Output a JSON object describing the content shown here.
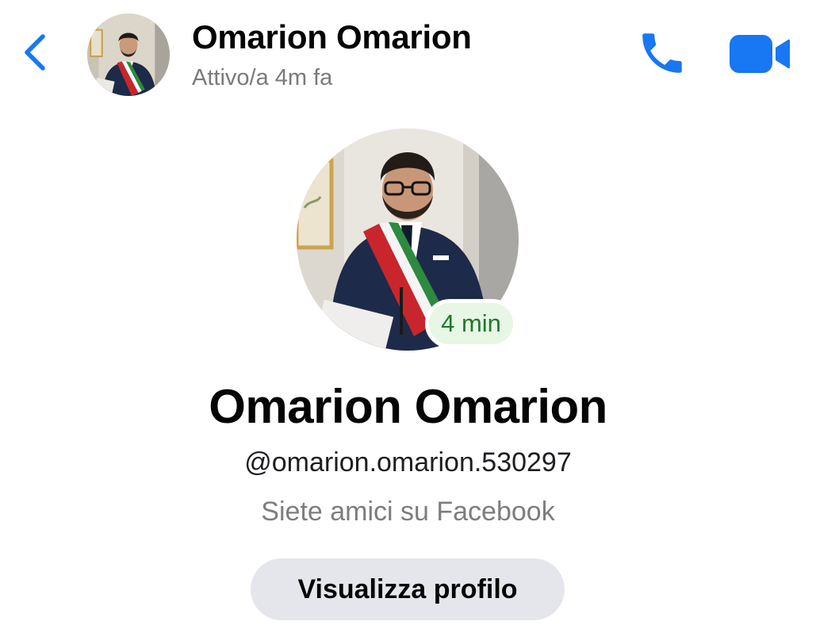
{
  "header": {
    "contact_name": "Omarion Omarion",
    "active_status": "Attivo/a 4m fa",
    "icons": {
      "back": "chevron-left-icon",
      "call": "phone-icon",
      "video": "video-camera-icon"
    }
  },
  "profile": {
    "active_badge": "4 min",
    "name": "Omarion Omarion",
    "username": "@omarion.omarion.530297",
    "friend_status": "Siete amici su Facebook",
    "view_profile_label": "Visualizza profilo"
  },
  "colors": {
    "accent": "#1877f2",
    "secondary_text": "#7a7a7a",
    "badge_text": "#1e7a2a",
    "badge_bg": "#e7f6e5",
    "button_bg": "#e4e6eb"
  }
}
